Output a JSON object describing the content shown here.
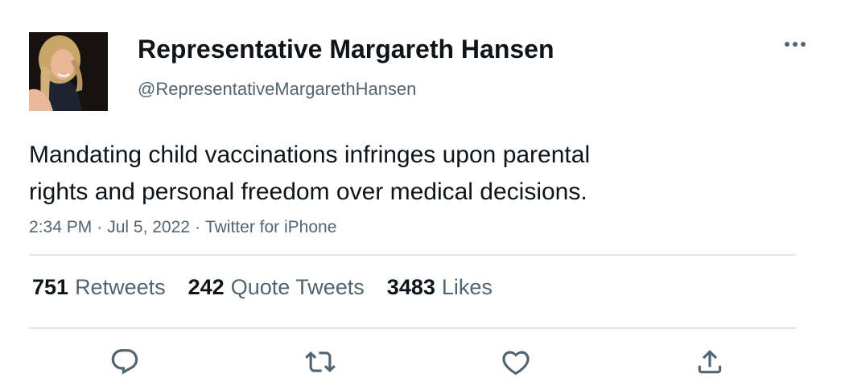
{
  "author": {
    "display_name": "Representative Margareth Hansen",
    "handle": "@RepresentativeMargarethHansen"
  },
  "tweet": {
    "text_line1": "Mandating child vaccinations infringes upon parental",
    "text_line2": "rights and personal freedom over medical decisions.",
    "time": "2:34 PM",
    "date": "Jul 5, 2022",
    "source": "Twitter for iPhone",
    "separator": "·"
  },
  "stats": {
    "retweets_count": "751",
    "retweets_label": "Retweets",
    "quotes_count": "242",
    "quotes_label": "Quote Tweets",
    "likes_count": "3483",
    "likes_label": "Likes"
  },
  "icons": {
    "more": "more-horizontal-icon",
    "reply": "reply-icon",
    "retweet": "retweet-icon",
    "like": "heart-icon",
    "share": "share-icon"
  },
  "colors": {
    "text": "#0f1419",
    "secondary": "#536471",
    "divider": "#e3e6e8"
  }
}
